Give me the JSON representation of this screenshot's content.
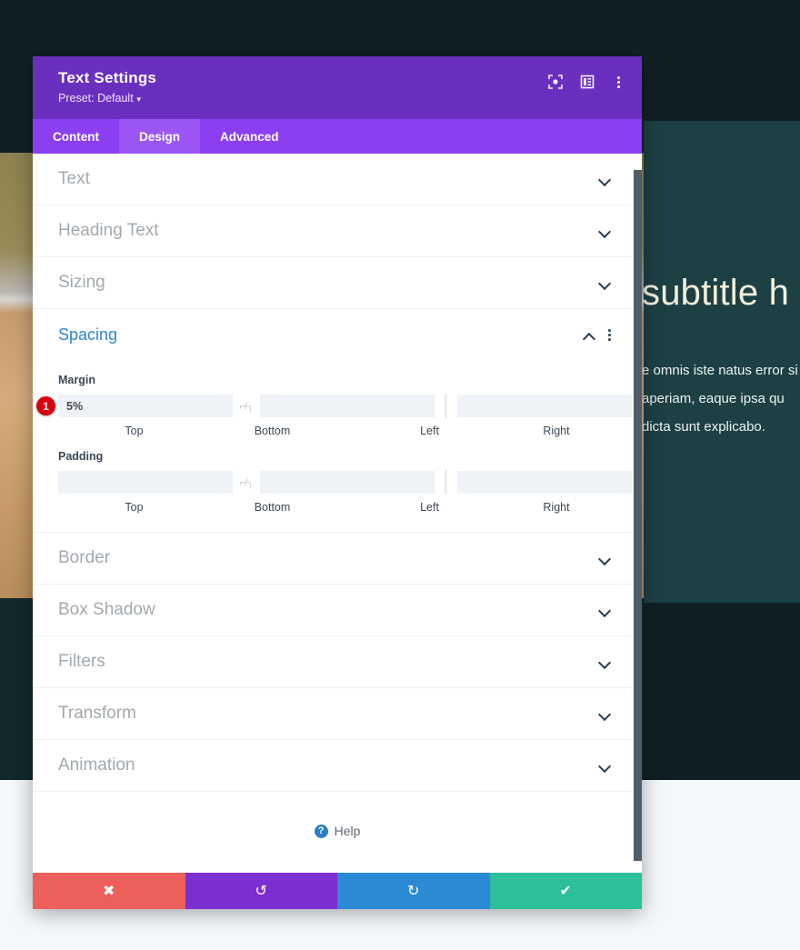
{
  "background": {
    "heading": "subtitle h",
    "body_lines": [
      "e omnis iste natus error si",
      "aperiam, eaque ipsa qu",
      "dicta sunt explicabo."
    ]
  },
  "modal": {
    "title": "Text Settings",
    "preset": "Preset: Default",
    "header_icons": [
      {
        "name": "focus-icon"
      },
      {
        "name": "layout-icon"
      },
      {
        "name": "more-options-icon"
      }
    ],
    "tabs": [
      {
        "label": "Content",
        "active": false
      },
      {
        "label": "Design",
        "active": true
      },
      {
        "label": "Advanced",
        "active": false
      }
    ],
    "sections": [
      {
        "label": "Text",
        "open": false
      },
      {
        "label": "Heading Text",
        "open": false
      },
      {
        "label": "Sizing",
        "open": false
      },
      {
        "label": "Spacing",
        "open": true
      },
      {
        "label": "Border",
        "open": false
      },
      {
        "label": "Box Shadow",
        "open": false
      },
      {
        "label": "Filters",
        "open": false
      },
      {
        "label": "Transform",
        "open": false
      },
      {
        "label": "Animation",
        "open": false
      }
    ],
    "spacing": {
      "margin_label": "Margin",
      "padding_label": "Padding",
      "link_icon_glyph": "⌐/┐",
      "badge_number": "1",
      "margin": {
        "top": "5%",
        "bottom": "",
        "left": "",
        "right": "",
        "top_label": "Top",
        "bottom_label": "Bottom",
        "left_label": "Left",
        "right_label": "Right"
      },
      "padding": {
        "top": "",
        "bottom": "",
        "left": "",
        "right": "",
        "top_label": "Top",
        "bottom_label": "Bottom",
        "left_label": "Left",
        "right_label": "Right"
      }
    },
    "help": {
      "label": "Help",
      "glyph": "?"
    },
    "footer": [
      {
        "name": "cancel-button",
        "glyph": "✖",
        "color": "#ec5f5a"
      },
      {
        "name": "undo-button",
        "glyph": "↺",
        "color": "#7b2fd1"
      },
      {
        "name": "redo-button",
        "glyph": "↻",
        "color": "#2a8ad4"
      },
      {
        "name": "save-button",
        "glyph": "✔",
        "color": "#2bbf9a"
      }
    ]
  },
  "colors": {
    "header_purple": "#6b2fc0",
    "tabbar_purple": "#8c3ff0",
    "tab_active": "#9b55f5",
    "accent_blue": "#2e86c9",
    "badge_red": "#d8000c"
  }
}
